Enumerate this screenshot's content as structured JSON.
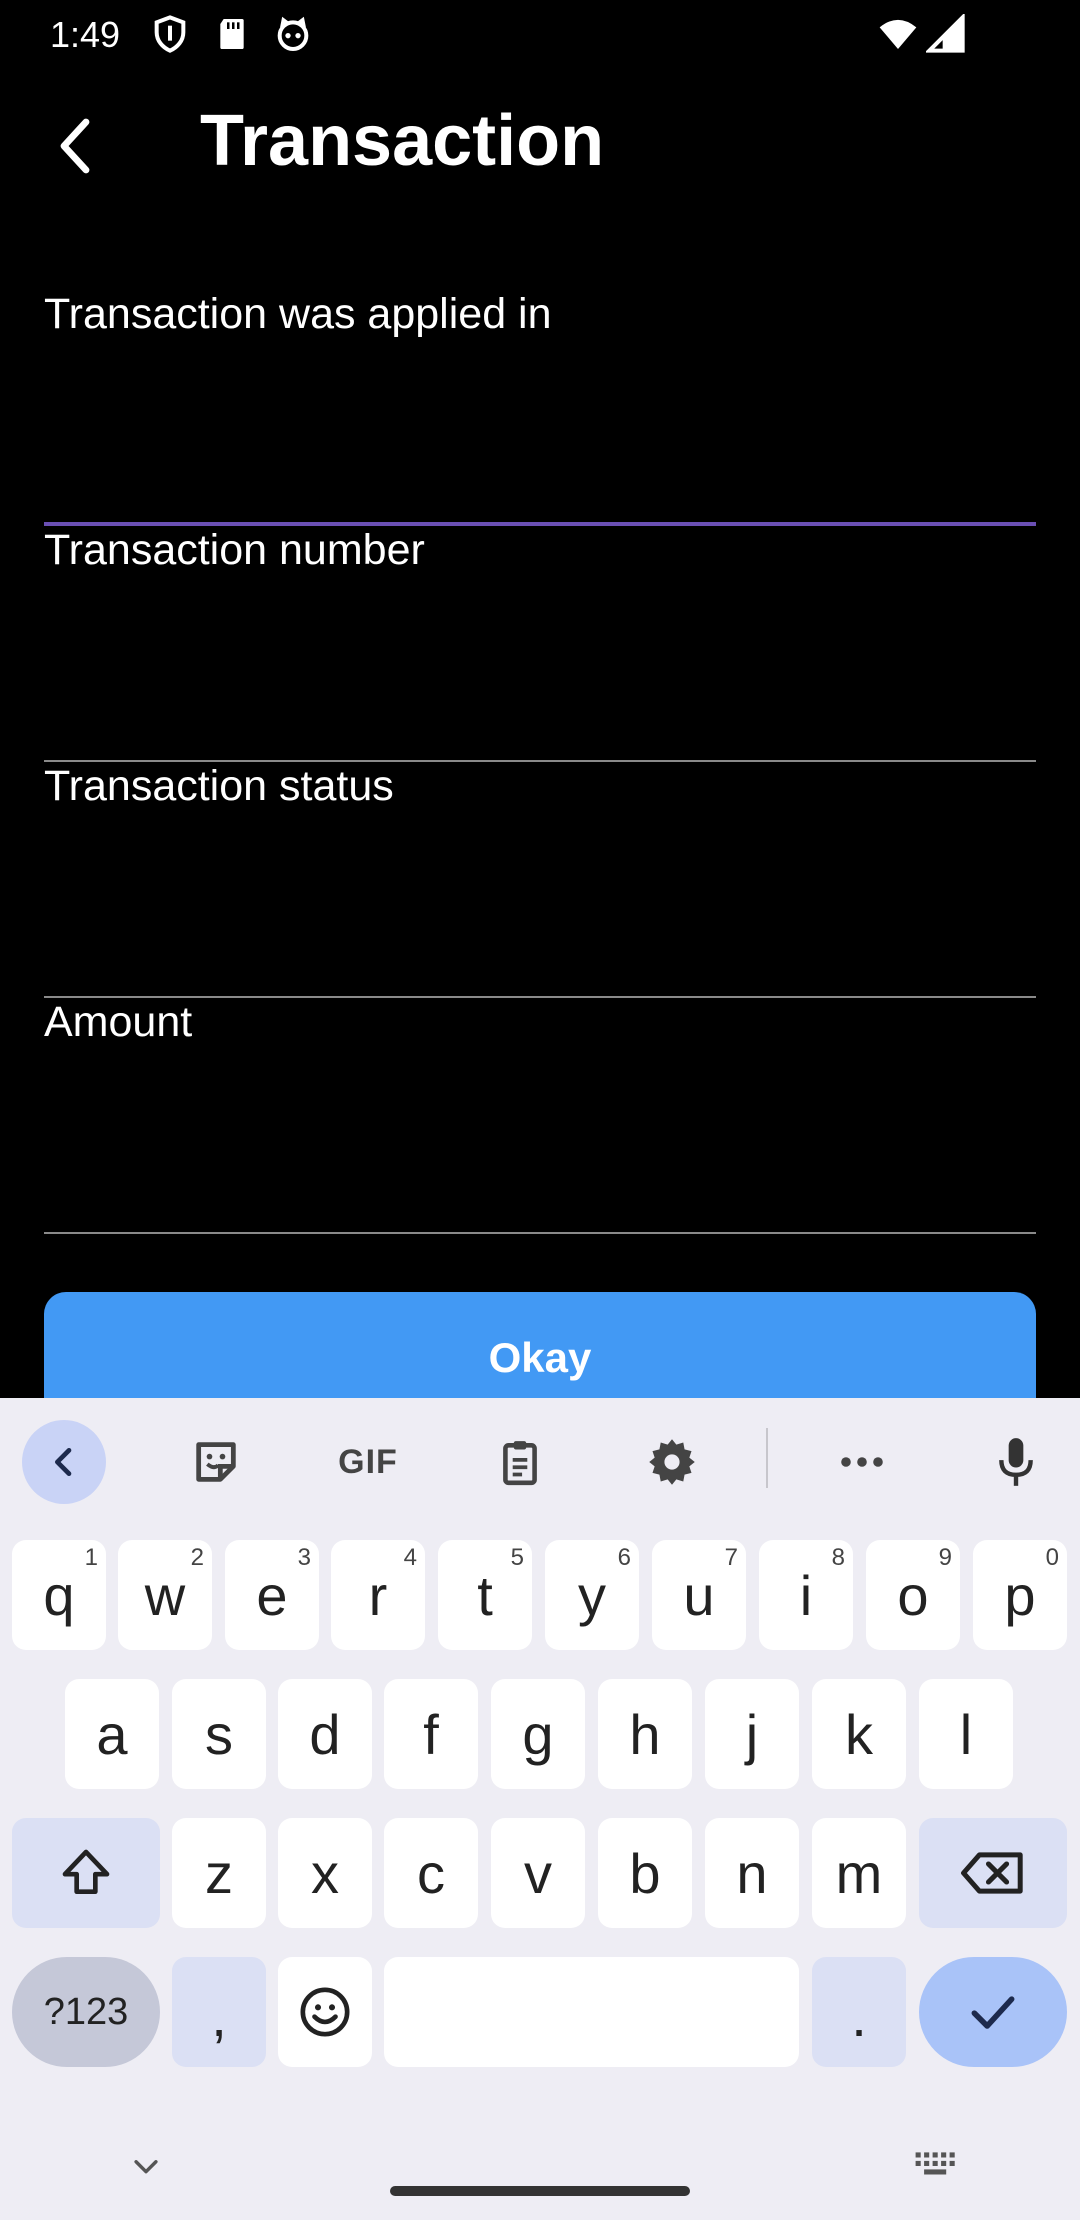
{
  "status_bar": {
    "time": "1:49",
    "icons": [
      "shield-icon",
      "sd-card-icon",
      "cat-icon",
      "wifi-icon",
      "signal-icon"
    ]
  },
  "app_bar": {
    "title": "Transaction",
    "back_icon": "arrow-back-icon"
  },
  "form": {
    "fields": [
      {
        "label": "Transaction was applied in",
        "value": "",
        "focused": true
      },
      {
        "label": "Transaction number",
        "value": ""
      },
      {
        "label": "Transaction status",
        "value": ""
      },
      {
        "label": "Amount",
        "value": ""
      }
    ],
    "okay_label": "Okay"
  },
  "colors": {
    "background": "#000000",
    "accent_focus_line": "#6a4fb3",
    "button": "#4299f4",
    "keyboard_bg": "#eeedf4"
  },
  "keyboard": {
    "toolbar": {
      "gif_label": "GIF",
      "icons": [
        "chevron-left-icon",
        "sticker-icon",
        "gif-icon",
        "clipboard-icon",
        "gear-icon",
        "more-icon",
        "microphone-icon"
      ]
    },
    "row1": [
      {
        "k": "q",
        "h": "1"
      },
      {
        "k": "w",
        "h": "2"
      },
      {
        "k": "e",
        "h": "3"
      },
      {
        "k": "r",
        "h": "4"
      },
      {
        "k": "t",
        "h": "5"
      },
      {
        "k": "y",
        "h": "6"
      },
      {
        "k": "u",
        "h": "7"
      },
      {
        "k": "i",
        "h": "8"
      },
      {
        "k": "o",
        "h": "9"
      },
      {
        "k": "p",
        "h": "0"
      }
    ],
    "row2": [
      "a",
      "s",
      "d",
      "f",
      "g",
      "h",
      "j",
      "k",
      "l"
    ],
    "row3": [
      "z",
      "x",
      "c",
      "v",
      "b",
      "n",
      "m"
    ],
    "symbols_label": "?123",
    "comma_label": ",",
    "period_label": "."
  }
}
